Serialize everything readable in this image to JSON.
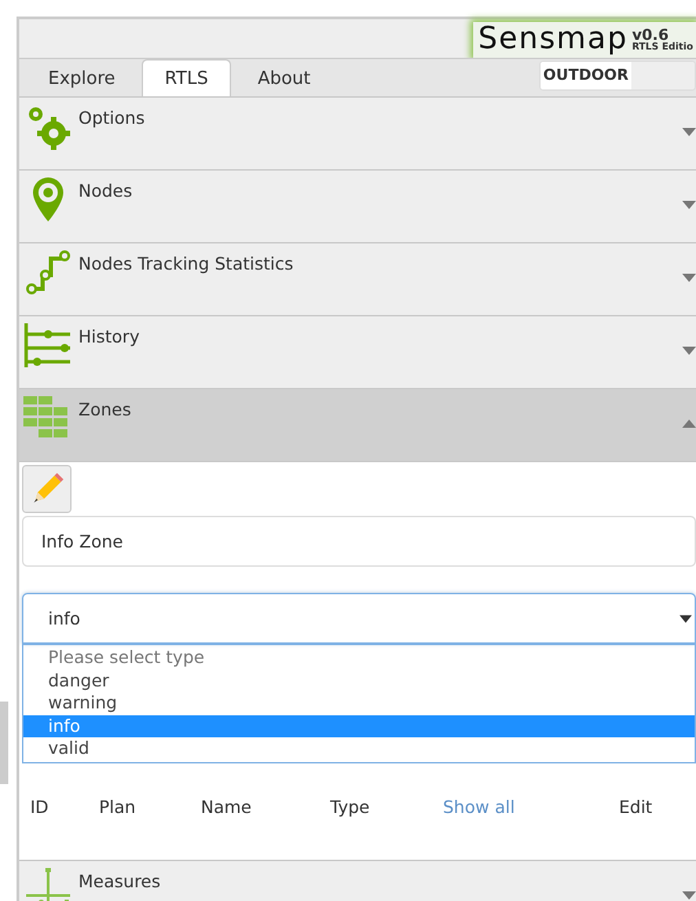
{
  "logo": {
    "name": "Sensmap",
    "version": "v0.6",
    "edition": "RTLS Editio"
  },
  "tabs": [
    {
      "label": "Explore",
      "selected": false
    },
    {
      "label": "RTLS",
      "selected": true
    },
    {
      "label": "About",
      "selected": false
    }
  ],
  "mode_toggle": {
    "label": "OUTDOOR",
    "on": false
  },
  "sections": [
    {
      "title": "Options",
      "kind": "gears",
      "expanded": false
    },
    {
      "title": "Nodes",
      "kind": "pin",
      "expanded": false
    },
    {
      "title": "Nodes Tracking Statistics",
      "kind": "track",
      "expanded": false
    },
    {
      "title": "History",
      "kind": "history",
      "expanded": false
    },
    {
      "title": "Zones",
      "kind": "zones",
      "expanded": true
    }
  ],
  "zones": {
    "name_value": "Info Zone",
    "type_value": "info",
    "type_options": [
      {
        "label": "Please select type",
        "selected": false,
        "kind": "hint"
      },
      {
        "label": "danger",
        "selected": false,
        "kind": "option"
      },
      {
        "label": "warning",
        "selected": false,
        "kind": "option"
      },
      {
        "label": "info",
        "selected": true,
        "kind": "option"
      },
      {
        "label": "valid",
        "selected": false,
        "kind": "option"
      }
    ],
    "columns": [
      {
        "label": "ID",
        "kind": "text"
      },
      {
        "label": "Plan",
        "kind": "text"
      },
      {
        "label": "Name",
        "kind": "text"
      },
      {
        "label": "Type",
        "kind": "text"
      },
      {
        "label": "Show all",
        "kind": "link"
      },
      {
        "label": "Edit",
        "kind": "text"
      }
    ]
  },
  "bottom_section": {
    "title": "Measures",
    "kind": "measures",
    "expanded": false
  }
}
